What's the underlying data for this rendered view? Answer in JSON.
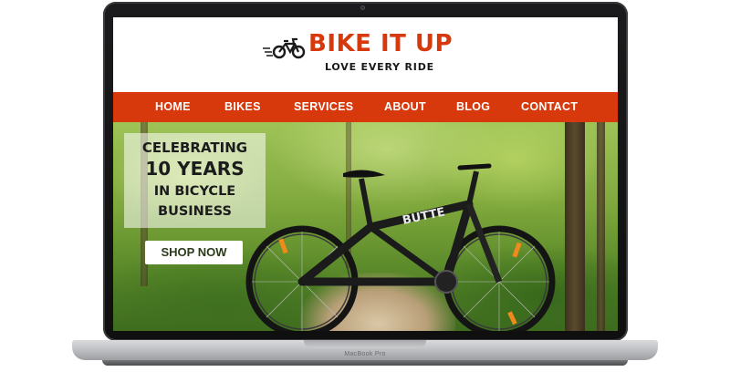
{
  "device": {
    "label": "MacBook Pro"
  },
  "site": {
    "name": "BIKE IT UP",
    "tagline": "LOVE EVERY RIDE",
    "accent_color": "#d7380c",
    "logo_icon": "bicycle-icon"
  },
  "nav": {
    "items": [
      {
        "label": "HOME"
      },
      {
        "label": "BIKES"
      },
      {
        "label": "SERVICES"
      },
      {
        "label": "ABOUT"
      },
      {
        "label": "BLOG"
      },
      {
        "label": "CONTACT"
      }
    ]
  },
  "hero": {
    "promo": {
      "line1": "CELEBRATING",
      "line2": "10 YEARS",
      "line3": "IN BICYCLE",
      "line4": "BUSINESS"
    },
    "cta_label": "SHOP NOW",
    "frame_text": "BUTTE"
  }
}
